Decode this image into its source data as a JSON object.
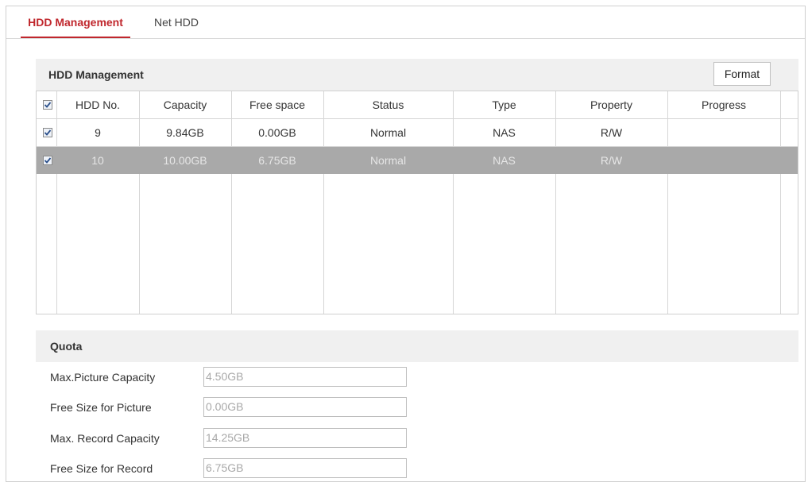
{
  "tabs": [
    {
      "label": "HDD Management",
      "active": true
    },
    {
      "label": "Net HDD",
      "active": false
    }
  ],
  "hdd_section": {
    "title": "HDD Management",
    "format_button": "Format"
  },
  "table": {
    "columns": [
      "HDD No.",
      "Capacity",
      "Free space",
      "Status",
      "Type",
      "Property",
      "Progress"
    ],
    "rows": [
      {
        "checked": true,
        "hdd_no": "9",
        "capacity": "9.84GB",
        "free_space": "0.00GB",
        "status": "Normal",
        "type": "NAS",
        "property": "R/W",
        "progress": ""
      },
      {
        "checked": true,
        "hdd_no": "10",
        "capacity": "10.00GB",
        "free_space": "6.75GB",
        "status": "Normal",
        "type": "NAS",
        "property": "R/W",
        "progress": "",
        "selected": true
      }
    ]
  },
  "quota": {
    "title": "Quota",
    "fields": [
      {
        "label": "Max.Picture Capacity",
        "value": "4.50GB"
      },
      {
        "label": "Free Size for Picture",
        "value": "0.00GB"
      },
      {
        "label": "Max. Record Capacity",
        "value": "14.25GB"
      },
      {
        "label": "Free Size for Record",
        "value": "6.75GB"
      }
    ]
  },
  "colors": {
    "accent": "#c0272d",
    "selected_row": "#a9a9a9",
    "section_bg": "#f0f0f0"
  }
}
